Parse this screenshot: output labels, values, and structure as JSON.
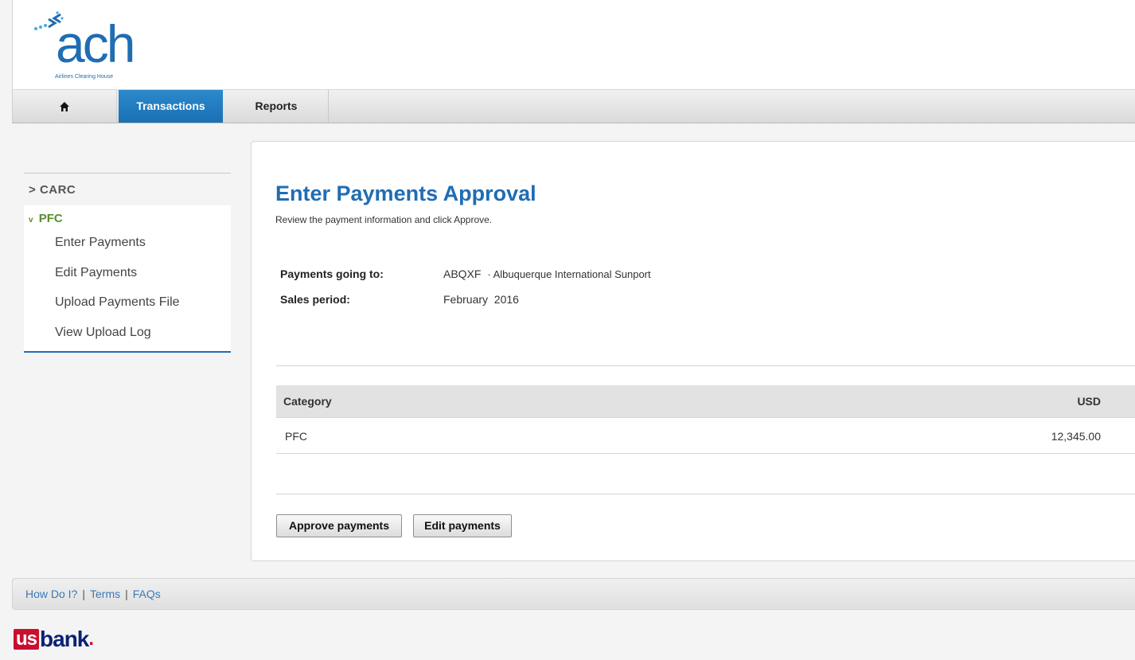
{
  "brand": {
    "logo_text": "ach",
    "tagline": "Airlines Clearing House",
    "primary_color": "#1f6db3"
  },
  "nav": {
    "home_icon": "home-icon",
    "tabs": [
      {
        "label": "Transactions",
        "active": true
      },
      {
        "label": "Reports",
        "active": false
      }
    ]
  },
  "sidebar": {
    "carc": {
      "label": "CARC",
      "marker": ">"
    },
    "pfc": {
      "label": "PFC",
      "marker": "v"
    },
    "items": [
      {
        "label": "Enter Payments"
      },
      {
        "label": "Edit Payments"
      },
      {
        "label": "Upload Payments File"
      },
      {
        "label": "View Upload Log"
      }
    ]
  },
  "main": {
    "title": "Enter Payments Approval",
    "subtitle": "Review the payment information and click Approve.",
    "payments_to_label": "Payments going to:",
    "payments_to_code": "ABQXF",
    "payments_to_name": "· Albuquerque International Sunport",
    "sales_period_label": "Sales period:",
    "sales_period_value": "February  2016",
    "table": {
      "headers": [
        "Category",
        "USD"
      ],
      "rows": [
        {
          "category": "PFC",
          "usd": "12,345.00"
        }
      ]
    },
    "approve_label": "Approve payments",
    "edit_label": "Edit payments"
  },
  "footer": {
    "links": [
      "How Do I?",
      "Terms",
      "FAQs"
    ],
    "separator": "|"
  },
  "sponsor": {
    "us": "us",
    "bank": "bank",
    "dot": ".",
    "colors": {
      "red": "#c8102e",
      "navy": "#0c2074"
    }
  }
}
